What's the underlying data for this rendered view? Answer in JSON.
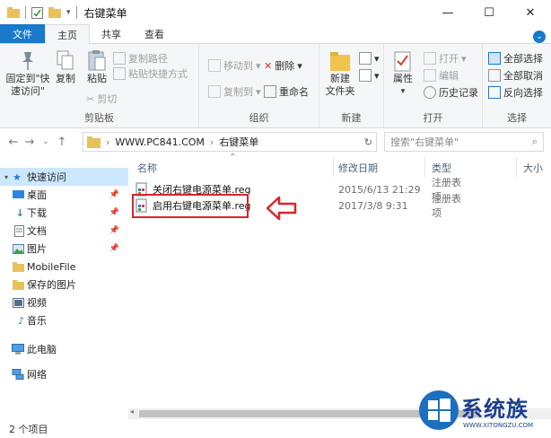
{
  "window": {
    "title": "右键菜单",
    "minimize": "—",
    "maximize": "☐",
    "close": "✕"
  },
  "tabs": [
    {
      "label": "文件"
    },
    {
      "label": "主页"
    },
    {
      "label": "共享"
    },
    {
      "label": "查看"
    }
  ],
  "ribbon": {
    "clipboard": {
      "label": "剪贴板",
      "pin_quick_access": "固定到\"快\n速访问\"",
      "copy": "复制",
      "paste": "粘贴",
      "copy_path": "复制路径",
      "paste_shortcut": "粘贴快捷方式",
      "cut": "剪切"
    },
    "organize": {
      "label": "组织",
      "move_to": "移动到",
      "copy_to": "复制到",
      "delete": "删除",
      "rename": "重命名"
    },
    "new": {
      "label": "新建",
      "new_folder": "新建\n文件夹"
    },
    "open": {
      "label": "打开",
      "properties": "属性",
      "open": "打开",
      "edit": "编辑",
      "history": "历史记录"
    },
    "select": {
      "label": "选择",
      "select_all": "全部选择",
      "select_none": "全部取消",
      "invert": "反向选择"
    }
  },
  "address": {
    "segments": [
      "WWW.PC841.COM",
      "右键菜单"
    ],
    "search_placeholder": "搜索\"右键菜单\""
  },
  "nav": {
    "items": [
      {
        "label": "快速访问",
        "pinned": false
      },
      {
        "label": "桌面",
        "pinned": true
      },
      {
        "label": "下载",
        "pinned": true
      },
      {
        "label": "文档",
        "pinned": true
      },
      {
        "label": "图片",
        "pinned": true
      },
      {
        "label": "MobileFile",
        "pinned": false
      },
      {
        "label": "保存的图片",
        "pinned": false
      },
      {
        "label": "视频",
        "pinned": false
      },
      {
        "label": "音乐",
        "pinned": false
      },
      {
        "label": "此电脑",
        "pinned": false
      },
      {
        "label": "网络",
        "pinned": false
      }
    ]
  },
  "columns": {
    "name": "名称",
    "modified": "修改日期",
    "type": "类型",
    "size": "大小"
  },
  "files": [
    {
      "name": "关闭右键电源菜单.reg",
      "modified": "2015/6/13 21:29",
      "type": "注册表项"
    },
    {
      "name": "启用右键电源菜单.reg",
      "modified": "2017/3/8 9:31",
      "type": "注册表项"
    }
  ],
  "status": {
    "count": "2 个项目"
  },
  "watermark": {
    "brand": "系统族",
    "url": "WWW.XITONGZU.COM"
  },
  "colors": {
    "accent": "#1979ca",
    "highlight": "#d9252a",
    "selected": "#cce8ff"
  }
}
